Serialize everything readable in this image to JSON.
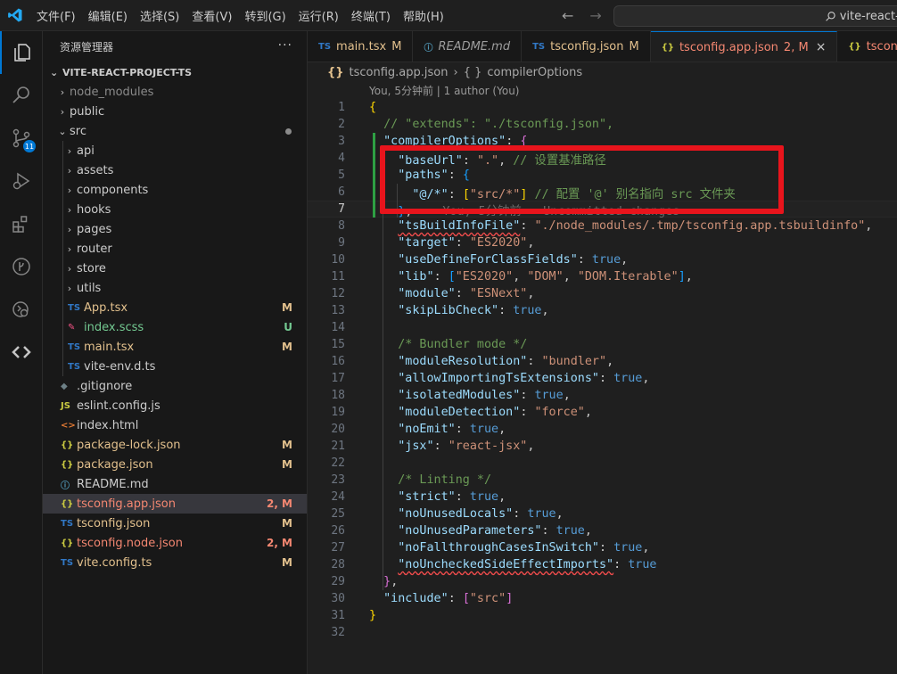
{
  "menu": [
    "文件(F)",
    "编辑(E)",
    "选择(S)",
    "查看(V)",
    "转到(G)",
    "运行(R)",
    "终端(T)",
    "帮助(H)"
  ],
  "search": {
    "text": "vite-react-p"
  },
  "activity": {
    "scm_badge": "11"
  },
  "explorer": {
    "title": "资源管理器",
    "more": "···",
    "project": "VITE-REACT-PROJECT-TS",
    "items": [
      {
        "label": "node_modules",
        "type": "folder",
        "open": false,
        "depth": 1,
        "color": "#8b8b8b"
      },
      {
        "label": "public",
        "type": "folder",
        "open": false,
        "depth": 1,
        "color": "#cccccc"
      },
      {
        "label": "src",
        "type": "folder",
        "open": true,
        "depth": 1,
        "color": "#cccccc",
        "dot": true
      },
      {
        "label": "api",
        "type": "folder",
        "open": false,
        "depth": 2,
        "color": "#cccccc"
      },
      {
        "label": "assets",
        "type": "folder",
        "open": false,
        "depth": 2,
        "color": "#cccccc"
      },
      {
        "label": "components",
        "type": "folder",
        "open": false,
        "depth": 2,
        "color": "#cccccc"
      },
      {
        "label": "hooks",
        "type": "folder",
        "open": false,
        "depth": 2,
        "color": "#cccccc"
      },
      {
        "label": "pages",
        "type": "folder",
        "open": false,
        "depth": 2,
        "color": "#cccccc"
      },
      {
        "label": "router",
        "type": "folder",
        "open": false,
        "depth": 2,
        "color": "#cccccc"
      },
      {
        "label": "store",
        "type": "folder",
        "open": false,
        "depth": 2,
        "color": "#cccccc"
      },
      {
        "label": "utils",
        "type": "folder",
        "open": false,
        "depth": 2,
        "color": "#cccccc"
      },
      {
        "label": "App.tsx",
        "type": "file",
        "icon": "TS",
        "iconColor": "#3178c6",
        "depth": 2,
        "color": "#e2c08d",
        "status": "M",
        "statusColor": "#e2c08d"
      },
      {
        "label": "index.scss",
        "type": "file",
        "icon": "✎",
        "iconColor": "#f55385",
        "depth": 2,
        "color": "#73c991",
        "status": "U",
        "statusColor": "#73c991"
      },
      {
        "label": "main.tsx",
        "type": "file",
        "icon": "TS",
        "iconColor": "#3178c6",
        "depth": 2,
        "color": "#e2c08d",
        "status": "M",
        "statusColor": "#e2c08d"
      },
      {
        "label": "vite-env.d.ts",
        "type": "file",
        "icon": "TS",
        "iconColor": "#3178c6",
        "depth": 2,
        "color": "#cccccc"
      },
      {
        "label": ".gitignore",
        "type": "file",
        "icon": "◆",
        "iconColor": "#6d8086",
        "depth": 1,
        "color": "#cccccc"
      },
      {
        "label": "eslint.config.js",
        "type": "file",
        "icon": "JS",
        "iconColor": "#cbcb41",
        "depth": 1,
        "color": "#cccccc"
      },
      {
        "label": "index.html",
        "type": "file",
        "icon": "<>",
        "iconColor": "#e37933",
        "depth": 1,
        "color": "#cccccc"
      },
      {
        "label": "package-lock.json",
        "type": "file",
        "icon": "{}",
        "iconColor": "#cbcb41",
        "depth": 1,
        "color": "#e2c08d",
        "status": "M",
        "statusColor": "#e2c08d"
      },
      {
        "label": "package.json",
        "type": "file",
        "icon": "{}",
        "iconColor": "#cbcb41",
        "depth": 1,
        "color": "#e2c08d",
        "status": "M",
        "statusColor": "#e2c08d"
      },
      {
        "label": "README.md",
        "type": "file",
        "icon": "ⓘ",
        "iconColor": "#519aba",
        "depth": 1,
        "color": "#cccccc"
      },
      {
        "label": "tsconfig.app.json",
        "type": "file",
        "icon": "{}",
        "iconColor": "#cbcb41",
        "depth": 1,
        "color": "#f48771",
        "status": "2, M",
        "statusColor": "#f48771",
        "selected": true
      },
      {
        "label": "tsconfig.json",
        "type": "file",
        "icon": "TS",
        "iconColor": "#3178c6",
        "depth": 1,
        "color": "#e2c08d",
        "status": "M",
        "statusColor": "#e2c08d"
      },
      {
        "label": "tsconfig.node.json",
        "type": "file",
        "icon": "{}",
        "iconColor": "#cbcb41",
        "depth": 1,
        "color": "#f48771",
        "status": "2, M",
        "statusColor": "#f48771"
      },
      {
        "label": "vite.config.ts",
        "type": "file",
        "icon": "TS",
        "iconColor": "#3178c6",
        "depth": 1,
        "color": "#e2c08d",
        "status": "M",
        "statusColor": "#e2c08d"
      }
    ]
  },
  "tabs": [
    {
      "label": "main.tsx",
      "icon": "TS",
      "iconColor": "#3178c6",
      "status": "M",
      "color": "#e2c08d"
    },
    {
      "label": "README.md",
      "icon": "ⓘ",
      "iconColor": "#519aba",
      "status": "",
      "color": "#9d9d9d",
      "italic": true
    },
    {
      "label": "tsconfig.json",
      "icon": "TS",
      "iconColor": "#3178c6",
      "status": "M",
      "color": "#e2c08d"
    },
    {
      "label": "tsconfig.app.json",
      "icon": "{}",
      "iconColor": "#cbcb41",
      "status": "2, M",
      "color": "#f48771",
      "active": true,
      "close": "×"
    },
    {
      "label": "tsconfig.n",
      "icon": "{}",
      "iconColor": "#cbcb41",
      "status": "",
      "color": "#f48771"
    }
  ],
  "breadcrumb": {
    "file": "tsconfig.app.json",
    "separator": "›",
    "symbol": "compilerOptions"
  },
  "codelens": "You, 5分钟前 | 1 author (You)",
  "editor": {
    "current_line": 7,
    "ghost_text": "You, 5分钟前 • Uncommitted changes",
    "lines": [
      {
        "n": "1",
        "tokens": [
          [
            "y",
            "{"
          ]
        ]
      },
      {
        "n": "2",
        "tokens": [
          [
            "p",
            "  "
          ],
          [
            "c",
            "// \"extends\": \"./tsconfig.json\","
          ]
        ]
      },
      {
        "n": "3",
        "tokens": [
          [
            "p",
            "  "
          ],
          [
            "k",
            "\"compilerOptions\""
          ],
          [
            "p",
            ": "
          ],
          [
            "m",
            "{"
          ]
        ]
      },
      {
        "n": "4",
        "tokens": [
          [
            "p",
            "    "
          ],
          [
            "k",
            "\"baseUrl\""
          ],
          [
            "p",
            ": "
          ],
          [
            "s",
            "\".\""
          ],
          [
            "p",
            ", "
          ],
          [
            "c",
            "// 设置基准路径"
          ]
        ]
      },
      {
        "n": "5",
        "tokens": [
          [
            "p",
            "    "
          ],
          [
            "k",
            "\"paths\""
          ],
          [
            "p",
            ": "
          ],
          [
            "blue",
            "{"
          ]
        ]
      },
      {
        "n": "6",
        "tokens": [
          [
            "p",
            "      "
          ],
          [
            "k",
            "\"@/*\""
          ],
          [
            "p",
            ": "
          ],
          [
            "y",
            "["
          ],
          [
            "s",
            "\"src/*\""
          ],
          [
            "y",
            "]"
          ],
          [
            "p",
            " "
          ],
          [
            "c",
            "// 配置 '@' 别名指向 src 文件夹"
          ]
        ]
      },
      {
        "n": "7",
        "tokens": [
          [
            "p",
            "    "
          ],
          [
            "blue",
            "}"
          ],
          [
            "p",
            ","
          ]
        ]
      },
      {
        "n": "8",
        "tokens": [
          [
            "p",
            "    "
          ],
          [
            "k sq",
            "\"tsBuildInfoFile\""
          ],
          [
            "p",
            ": "
          ],
          [
            "s",
            "\"./node_modules/.tmp/tsconfig.app.tsbuildinfo\""
          ],
          [
            "p",
            ","
          ]
        ]
      },
      {
        "n": "9",
        "tokens": [
          [
            "p",
            "    "
          ],
          [
            "k",
            "\"target\""
          ],
          [
            "p",
            ": "
          ],
          [
            "s",
            "\"ES2020\""
          ],
          [
            "p",
            ","
          ]
        ]
      },
      {
        "n": "10",
        "tokens": [
          [
            "p",
            "    "
          ],
          [
            "k",
            "\"useDefineForClassFields\""
          ],
          [
            "p",
            ": "
          ],
          [
            "b",
            "true"
          ],
          [
            "p",
            ","
          ]
        ]
      },
      {
        "n": "11",
        "tokens": [
          [
            "p",
            "    "
          ],
          [
            "k",
            "\"lib\""
          ],
          [
            "p",
            ": "
          ],
          [
            "blue",
            "["
          ],
          [
            "s",
            "\"ES2020\""
          ],
          [
            "p",
            ", "
          ],
          [
            "s",
            "\"DOM\""
          ],
          [
            "p",
            ", "
          ],
          [
            "s",
            "\"DOM.Iterable\""
          ],
          [
            "blue",
            "]"
          ],
          [
            "p",
            ","
          ]
        ]
      },
      {
        "n": "12",
        "tokens": [
          [
            "p",
            "    "
          ],
          [
            "k",
            "\"module\""
          ],
          [
            "p",
            ": "
          ],
          [
            "s",
            "\"ESNext\""
          ],
          [
            "p",
            ","
          ]
        ]
      },
      {
        "n": "13",
        "tokens": [
          [
            "p",
            "    "
          ],
          [
            "k",
            "\"skipLibCheck\""
          ],
          [
            "p",
            ": "
          ],
          [
            "b",
            "true"
          ],
          [
            "p",
            ","
          ]
        ]
      },
      {
        "n": "14",
        "tokens": []
      },
      {
        "n": "15",
        "tokens": [
          [
            "p",
            "    "
          ],
          [
            "c",
            "/* Bundler mode */"
          ]
        ]
      },
      {
        "n": "16",
        "tokens": [
          [
            "p",
            "    "
          ],
          [
            "k",
            "\"moduleResolution\""
          ],
          [
            "p",
            ": "
          ],
          [
            "s",
            "\"bundler\""
          ],
          [
            "p",
            ","
          ]
        ]
      },
      {
        "n": "17",
        "tokens": [
          [
            "p",
            "    "
          ],
          [
            "k",
            "\"allowImportingTsExtensions\""
          ],
          [
            "p",
            ": "
          ],
          [
            "b",
            "true"
          ],
          [
            "p",
            ","
          ]
        ]
      },
      {
        "n": "18",
        "tokens": [
          [
            "p",
            "    "
          ],
          [
            "k",
            "\"isolatedModules\""
          ],
          [
            "p",
            ": "
          ],
          [
            "b",
            "true"
          ],
          [
            "p",
            ","
          ]
        ]
      },
      {
        "n": "19",
        "tokens": [
          [
            "p",
            "    "
          ],
          [
            "k",
            "\"moduleDetection\""
          ],
          [
            "p",
            ": "
          ],
          [
            "s",
            "\"force\""
          ],
          [
            "p",
            ","
          ]
        ]
      },
      {
        "n": "20",
        "tokens": [
          [
            "p",
            "    "
          ],
          [
            "k",
            "\"noEmit\""
          ],
          [
            "p",
            ": "
          ],
          [
            "b",
            "true"
          ],
          [
            "p",
            ","
          ]
        ]
      },
      {
        "n": "21",
        "tokens": [
          [
            "p",
            "    "
          ],
          [
            "k",
            "\"jsx\""
          ],
          [
            "p",
            ": "
          ],
          [
            "s",
            "\"react-jsx\""
          ],
          [
            "p",
            ","
          ]
        ]
      },
      {
        "n": "22",
        "tokens": []
      },
      {
        "n": "23",
        "tokens": [
          [
            "p",
            "    "
          ],
          [
            "c",
            "/* Linting */"
          ]
        ]
      },
      {
        "n": "24",
        "tokens": [
          [
            "p",
            "    "
          ],
          [
            "k",
            "\"strict\""
          ],
          [
            "p",
            ": "
          ],
          [
            "b",
            "true"
          ],
          [
            "p",
            ","
          ]
        ]
      },
      {
        "n": "25",
        "tokens": [
          [
            "p",
            "    "
          ],
          [
            "k",
            "\"noUnusedLocals\""
          ],
          [
            "p",
            ": "
          ],
          [
            "b",
            "true"
          ],
          [
            "p",
            ","
          ]
        ]
      },
      {
        "n": "26",
        "tokens": [
          [
            "p",
            "    "
          ],
          [
            "k",
            "\"noUnusedParameters\""
          ],
          [
            "p",
            ": "
          ],
          [
            "b",
            "true"
          ],
          [
            "p",
            ","
          ]
        ]
      },
      {
        "n": "27",
        "tokens": [
          [
            "p",
            "    "
          ],
          [
            "k",
            "\"noFallthroughCasesInSwitch\""
          ],
          [
            "p",
            ": "
          ],
          [
            "b",
            "true"
          ],
          [
            "p",
            ","
          ]
        ]
      },
      {
        "n": "28",
        "tokens": [
          [
            "p",
            "    "
          ],
          [
            "k sq",
            "\"noUncheckedSideEffectImports\""
          ],
          [
            "p",
            ": "
          ],
          [
            "b",
            "true"
          ]
        ]
      },
      {
        "n": "29",
        "tokens": [
          [
            "p",
            "  "
          ],
          [
            "m",
            "}"
          ],
          [
            "p",
            ","
          ]
        ]
      },
      {
        "n": "30",
        "tokens": [
          [
            "p",
            "  "
          ],
          [
            "k",
            "\"include\""
          ],
          [
            "p",
            ": "
          ],
          [
            "m",
            "["
          ],
          [
            "s",
            "\"src\""
          ],
          [
            "m",
            "]"
          ]
        ]
      },
      {
        "n": "31",
        "tokens": [
          [
            "y",
            "}"
          ]
        ]
      },
      {
        "n": "32",
        "tokens": []
      }
    ]
  }
}
